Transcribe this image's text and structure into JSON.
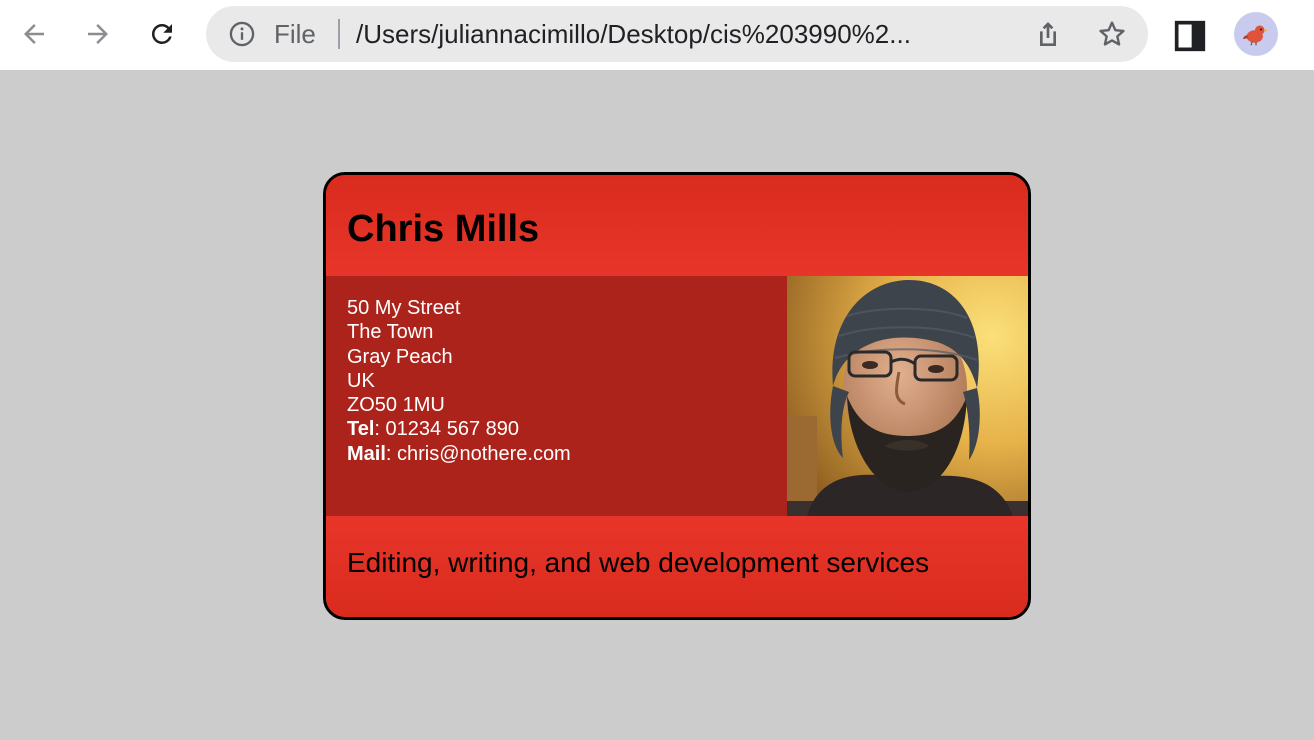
{
  "browser": {
    "scheme_label": "File",
    "url": "/Users/juliannacimillo/Desktop/cis%203990%2...",
    "icons": {
      "back": "back-arrow-icon",
      "forward": "forward-arrow-icon",
      "reload": "reload-icon",
      "info": "info-icon",
      "share": "share-icon",
      "bookmark": "star-icon",
      "side_panel": "side-panel-icon",
      "profile": "profile-avatar"
    }
  },
  "card": {
    "name": "Chris Mills",
    "address_lines": [
      "50 My Street",
      "The Town",
      "Gray Peach",
      "UK",
      "ZO50 1MU"
    ],
    "tel_label": "Tel",
    "tel_value": ": 01234 567 890",
    "mail_label": "Mail",
    "mail_value": ": chris@nothere.com",
    "tagline": "Editing, writing, and web development services",
    "colors": {
      "header": "#e8352a",
      "body": "#ac231b",
      "border": "#000000",
      "page_background": "#cccccc"
    }
  }
}
